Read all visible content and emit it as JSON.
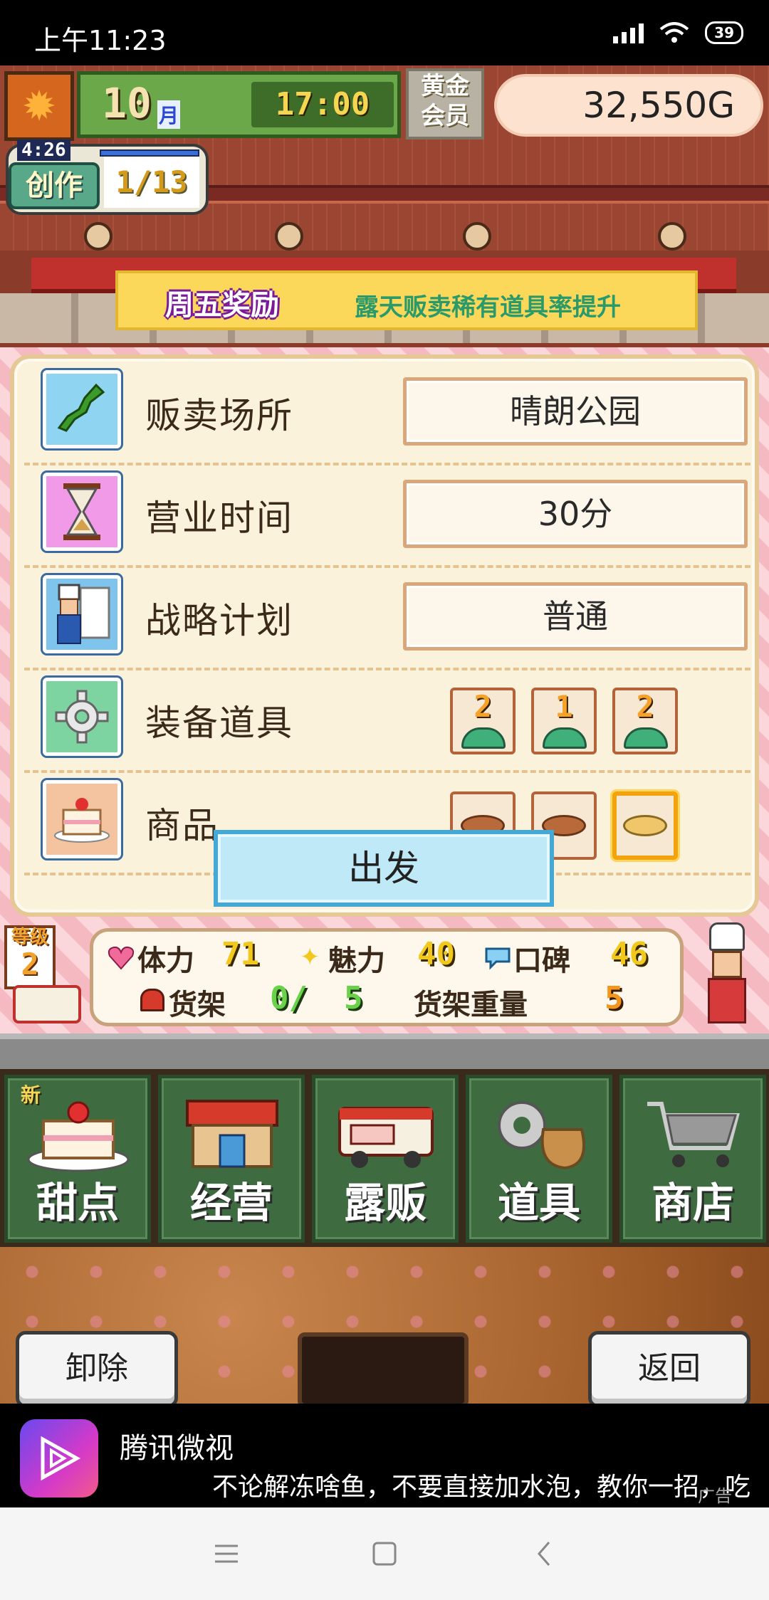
{
  "status_bar": {
    "time": "上午11:23",
    "battery": "39"
  },
  "hud": {
    "month": "10",
    "month_unit": "月",
    "time": "17:00",
    "member_line1": "黄金",
    "member_line2": "会员",
    "gold": "32,550G"
  },
  "create": {
    "timer": "4:26",
    "label": "创作",
    "count": "1/13"
  },
  "bonus": {
    "tag": "周五奖励",
    "text": "露天贩卖稀有道具率提升"
  },
  "panel": {
    "rows": [
      {
        "label": "贩卖场所",
        "value": "晴朗公园",
        "icon": "map-icon"
      },
      {
        "label": "营业时间",
        "value": "30分",
        "icon": "hourglass-icon"
      },
      {
        "label": "战略计划",
        "value": "普通",
        "icon": "chef-plan-icon"
      },
      {
        "label": "装备道具",
        "icon": "gear-icon"
      },
      {
        "label": "商品",
        "icon": "cake-icon"
      }
    ],
    "equipment": [
      "2",
      "1",
      "2"
    ],
    "depart_label": "出发"
  },
  "stats": {
    "level_label": "等级",
    "level": "2",
    "stamina_label": "体力",
    "stamina": "71",
    "charm_label": "魅力",
    "charm": "40",
    "reputation_label": "口碑",
    "reputation": "46",
    "shelf_label": "货架",
    "shelf_used": "0/",
    "shelf_total": "5",
    "shelf_weight_label": "货架重量",
    "shelf_weight": "5"
  },
  "menu": {
    "new_tag": "新",
    "items": [
      {
        "label": "甜点",
        "icon": "cake-icon"
      },
      {
        "label": "经营",
        "icon": "shop-icon"
      },
      {
        "label": "露贩",
        "icon": "van-icon"
      },
      {
        "label": "道具",
        "icon": "item-bag-icon"
      },
      {
        "label": "商店",
        "icon": "cart-icon"
      }
    ]
  },
  "bottom": {
    "remove_label": "卸除",
    "back_label": "返回"
  },
  "ad": {
    "title": "腾讯微视",
    "text": "不论解冻啥鱼，不要直接加水泡，教你一招，吃",
    "tag": "广告"
  },
  "colors": {
    "gold_pill": "#fde3cf",
    "panel": "#fbf2dc",
    "depart": "#bfe9f7",
    "menu_green": "#3f6b40"
  }
}
